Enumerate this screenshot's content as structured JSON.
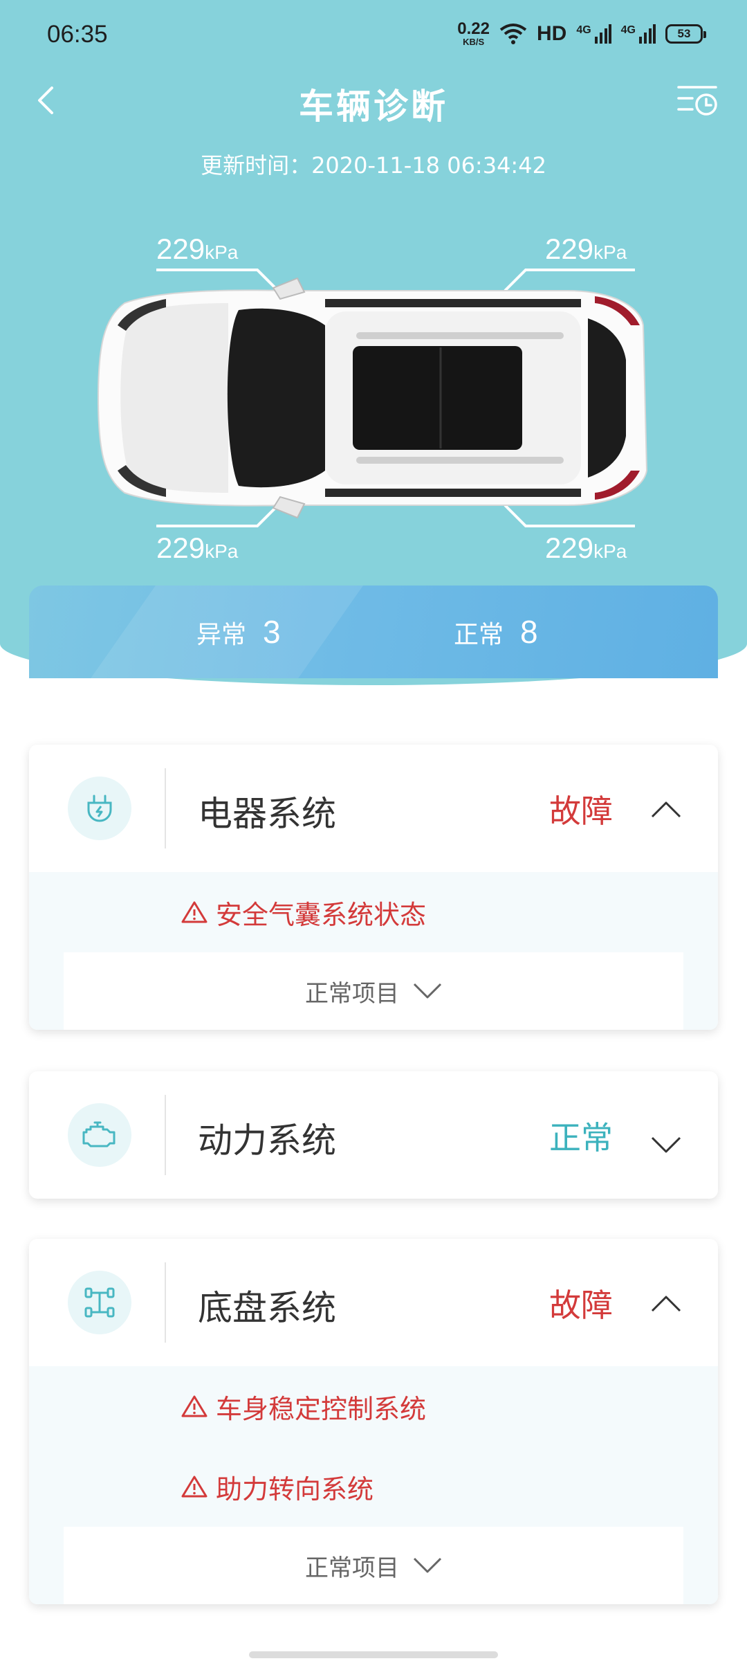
{
  "status_bar": {
    "time": "06:35",
    "net_speed_value": "0.22",
    "net_speed_unit": "KB/S",
    "hd_label": "HD",
    "signal_1_label": "4G",
    "signal_2_label": "4G",
    "battery": "53"
  },
  "nav": {
    "back_icon": "chevron-left-icon",
    "title": "车辆诊断",
    "history_icon": "history-list-icon"
  },
  "update_time": "更新时间：2020-11-18 06:34:42",
  "tires": {
    "front_left": {
      "value": "229",
      "unit": "kPa"
    },
    "front_right": {
      "value": "229",
      "unit": "kPa"
    },
    "rear_left": {
      "value": "229",
      "unit": "kPa"
    },
    "rear_right": {
      "value": "229",
      "unit": "kPa"
    }
  },
  "summary": {
    "abnormal_label": "异常",
    "abnormal_count": "3",
    "normal_label": "正常",
    "normal_count": "8"
  },
  "systems": [
    {
      "title": "电器系统",
      "status": "故障",
      "icon": "electrical-plug-icon",
      "expanded": true,
      "faults": [
        "安全气囊系统状态"
      ],
      "normal_button": "正常项目"
    },
    {
      "title": "动力系统",
      "status": "正常",
      "icon": "engine-icon",
      "expanded": false
    },
    {
      "title": "底盘系统",
      "status": "故障",
      "icon": "chassis-axle-icon",
      "expanded": true,
      "faults": [
        "车身稳定控制系统",
        "助力转向系统"
      ],
      "normal_button": "正常项目"
    }
  ],
  "colors": {
    "header_bg": "#86d2db",
    "fault_red": "#d33a3a",
    "ok_teal": "#3cb2bd",
    "summary_blue": "#6fbbe6"
  }
}
